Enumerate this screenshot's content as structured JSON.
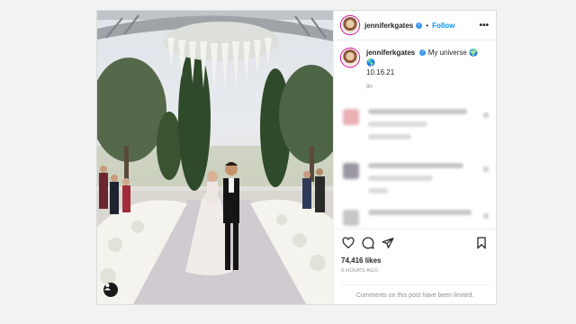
{
  "post": {
    "username": "jenniferkgates",
    "follow_label": "Follow",
    "separator": "•",
    "more_label": "•••",
    "caption_text": "My universe 🌍 🌎",
    "caption_date": "10.16.21",
    "caption_time": "9h",
    "likes": "74,416 likes",
    "posted": "9 HOURS AGO",
    "comments_limited": "Comments on this post have been limited."
  },
  "icons": {
    "like": "heart-icon",
    "comment": "comment-icon",
    "share": "share-icon",
    "save": "bookmark-icon",
    "verified": "verified-badge-icon",
    "tagged_user": "user-icon"
  },
  "colors": {
    "follow": "#0095f6",
    "verified": "#3897f0",
    "muted": "#8e8e8e"
  }
}
